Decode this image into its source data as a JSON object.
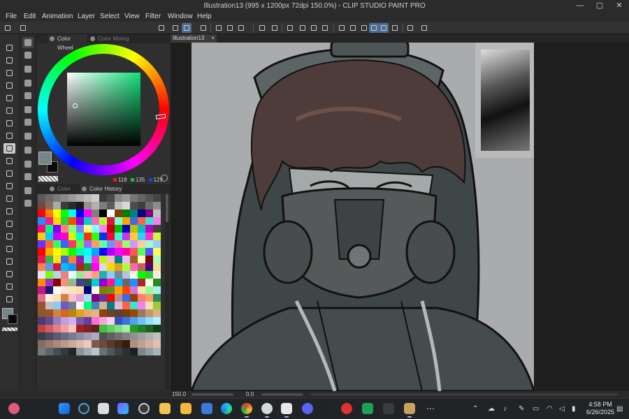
{
  "window": {
    "title": "Illustration13 (995 x 1200px 72dpi 150.0%) - CLIP STUDIO PAINT PRO",
    "controls": [
      "—",
      "▢",
      "✕"
    ]
  },
  "menu": [
    "File",
    "Edit",
    "Animation",
    "Layer",
    "Select",
    "View",
    "Filter",
    "Window",
    "Help"
  ],
  "color_panel": {
    "tab_active": "Color Wheel",
    "tab_inactive": "Color Mixing",
    "r": "118",
    "g": "135",
    "b": "129",
    "main_color": "#76858a",
    "sub_color": "#0a0a0a"
  },
  "palette_panel": {
    "tab_inactive": "Color Set",
    "tab_active": "Color History"
  },
  "document": {
    "tab": "Illustration13",
    "tab_close": "×"
  },
  "status": {
    "zoom": "150.0",
    "angle": "0.0"
  },
  "taskbar": {
    "time": "4:58 PM",
    "date": "6/26/2025"
  },
  "palette_colors": [
    "#5a5a5a",
    "#6a6a6a",
    "#7a7a7a",
    "#8a8a8a",
    "#9a9a9a",
    "#aaaaaa",
    "#bcbcbc",
    "#cccccc",
    "#3a3a3a",
    "#4a4a4a",
    "#888888",
    "#999999",
    "#777777",
    "#666666",
    "#555555",
    "#444444",
    "#6e4a3c",
    "#8b6a5a",
    "#a9a9a9",
    "#3c3c3c",
    "#2b2b2b",
    "#1a1a1a",
    "#9c8f85",
    "#b8b0a8",
    "#7c7c7c",
    "#5c5c5c",
    "#c0c0c0",
    "#d8d8d8",
    "#4c4c4c",
    "#3e3e3e",
    "#6c6c6c",
    "#8c8c8c",
    "#ff0000",
    "#ff8000",
    "#ffff00",
    "#00ff00",
    "#00ffff",
    "#0000ff",
    "#ff00ff",
    "#808080",
    "#000000",
    "#ffffff",
    "#804000",
    "#008000",
    "#008080",
    "#000080",
    "#800080",
    "#c0c0c0",
    "#1e90ff",
    "#ff1493",
    "#ffd700",
    "#32cd32",
    "#ff4500",
    "#9400d3",
    "#00ced1",
    "#ff69b4",
    "#adff2f",
    "#dc143c",
    "#7fffd4",
    "#ffa500",
    "#4169e1",
    "#ff6347",
    "#40e0d0",
    "#ee82ee",
    "#ff0080",
    "#00ff80",
    "#8000ff",
    "#ff8080",
    "#80ff80",
    "#8080ff",
    "#ffff80",
    "#80ffff",
    "#ff80ff",
    "#c00000",
    "#00c000",
    "#0000c0",
    "#c0c000",
    "#00c0c0",
    "#c000c0",
    "#404040",
    "#ffcc00",
    "#00ccff",
    "#cc00ff",
    "#ff00cc",
    "#ccff00",
    "#00ffcc",
    "#ff3300",
    "#33ff00",
    "#0033ff",
    "#ff0033",
    "#33ffcc",
    "#cc33ff",
    "#ffcc33",
    "#33ccff",
    "#ff33cc",
    "#ccff33",
    "#6633ff",
    "#ff6633",
    "#33ff66",
    "#3366ff",
    "#ff3366",
    "#66ff33",
    "#9966ff",
    "#ff9966",
    "#66ff99",
    "#6699ff",
    "#ff6699",
    "#99ff66",
    "#cc99ff",
    "#ffcc99",
    "#99ffcc",
    "#99ccff",
    "#ff0000",
    "#ffaa00",
    "#ffff00",
    "#aaff00",
    "#00ff00",
    "#00ffaa",
    "#00ffff",
    "#00aaff",
    "#0000ff",
    "#aa00ff",
    "#ff00ff",
    "#ff00aa",
    "#ff5555",
    "#55ff55",
    "#5555ff",
    "#ffff55",
    "#e6194b",
    "#3cb44b",
    "#ffe119",
    "#4363d8",
    "#f58231",
    "#911eb4",
    "#46f0f0",
    "#f032e6",
    "#bcf60c",
    "#fabebe",
    "#008080",
    "#e6beff",
    "#9a6324",
    "#fffac8",
    "#800000",
    "#aaffc3",
    "#ff7f50",
    "#6495ed",
    "#dc143c",
    "#00bfff",
    "#1e90ff",
    "#b22222",
    "#228b22",
    "#ff00ff",
    "#dcdcdc",
    "#ffd700",
    "#daa520",
    "#adff2f",
    "#ff69b4",
    "#cd5c5c",
    "#4b0082",
    "#f0e68c",
    "#e6e6fa",
    "#7cfc00",
    "#add8e6",
    "#f08080",
    "#e0ffff",
    "#90ee90",
    "#ffb6c1",
    "#ffa07a",
    "#20b2aa",
    "#87cefa",
    "#778899",
    "#b0c4de",
    "#ffffe0",
    "#00ff00",
    "#32cd32",
    "#faf0e6",
    "#ff8c00",
    "#9932cc",
    "#8b0000",
    "#e9967a",
    "#8fbc8f",
    "#483d8b",
    "#2f4f4f",
    "#00ced1",
    "#9400d3",
    "#ff1493",
    "#00bfff",
    "#696969",
    "#1e90ff",
    "#b22222",
    "#fffaf0",
    "#228b22",
    "#c71585",
    "#191970",
    "#f5fffa",
    "#ffe4e1",
    "#ffe4b5",
    "#ffdead",
    "#000080",
    "#fdf5e6",
    "#808000",
    "#6b8e23",
    "#ffa500",
    "#ff4500",
    "#da70d6",
    "#eee8aa",
    "#98fb98",
    "#afeeee",
    "#db7093",
    "#ffefd5",
    "#ffdab9",
    "#cd853f",
    "#ffc0cb",
    "#dda0dd",
    "#b0e0e6",
    "#800080",
    "#663399",
    "#ff0000",
    "#bc8f8f",
    "#4169e1",
    "#8b4513",
    "#fa8072",
    "#f4a460",
    "#2e8b57",
    "#a0522d",
    "#c0c0c0",
    "#87ceeb",
    "#6a5acd",
    "#708090",
    "#fffafa",
    "#00ff7f",
    "#4682b4",
    "#d2b48c",
    "#008080",
    "#d8bfd8",
    "#ff6347",
    "#40e0d0",
    "#ee82ee",
    "#f5deb3",
    "#9acd32",
    "#8b5a2b",
    "#a0522d",
    "#cd853f",
    "#d2691e",
    "#b8860b",
    "#daa520",
    "#f4a460",
    "#deb887",
    "#8b4513",
    "#6b4226",
    "#5c4033",
    "#7b3f00",
    "#964b00",
    "#a0785a",
    "#c19a6b",
    "#e0b080",
    "#4b3b7c",
    "#5d4d8c",
    "#9a7ac0",
    "#c0a0e0",
    "#d0b0f0",
    "#7a5ab0",
    "#6040a0",
    "#ff6fcf",
    "#ff9fdf",
    "#ffcfef",
    "#3050c0",
    "#4070e0",
    "#50a0f0",
    "#70c0ff",
    "#90e0ff",
    "#b0f0ff",
    "#c04040",
    "#d06060",
    "#e08080",
    "#f0a0a0",
    "#ffc0c0",
    "#a02020",
    "#802020",
    "#602020",
    "#40c040",
    "#60d060",
    "#80e080",
    "#a0f0a0",
    "#20a020",
    "#208020",
    "#206020",
    "#104010",
    "#3a3a50",
    "#4a4a60",
    "#5a5a70",
    "#6a6a80",
    "#7a7a90",
    "#8a8aa0",
    "#9a9ab0",
    "#aaaac0",
    "#505050",
    "#606060",
    "#707070",
    "#808080",
    "#909090",
    "#a0a0a0",
    "#b0b0b0",
    "#c0c0c0",
    "#8a6a5a",
    "#9a7a6a",
    "#aa8a7a",
    "#ba9a8a",
    "#caaa9a",
    "#dabaaa",
    "#eacaba",
    "#7a5a4a",
    "#6a4a3a",
    "#5a3a2a",
    "#4a2a1a",
    "#3a1a0a",
    "#b09080",
    "#c0a090",
    "#d0b0a0",
    "#e0c0b0",
    "#707a80",
    "#5a646a",
    "#464e52",
    "#333a3d",
    "#22282a",
    "#8a9499",
    "#a2acb1",
    "#bac4c9",
    "#687175",
    "#4f575b",
    "#3a4144",
    "#2a3033",
    "#1c2124",
    "#7c878c",
    "#939ea3",
    "#aab5ba"
  ]
}
